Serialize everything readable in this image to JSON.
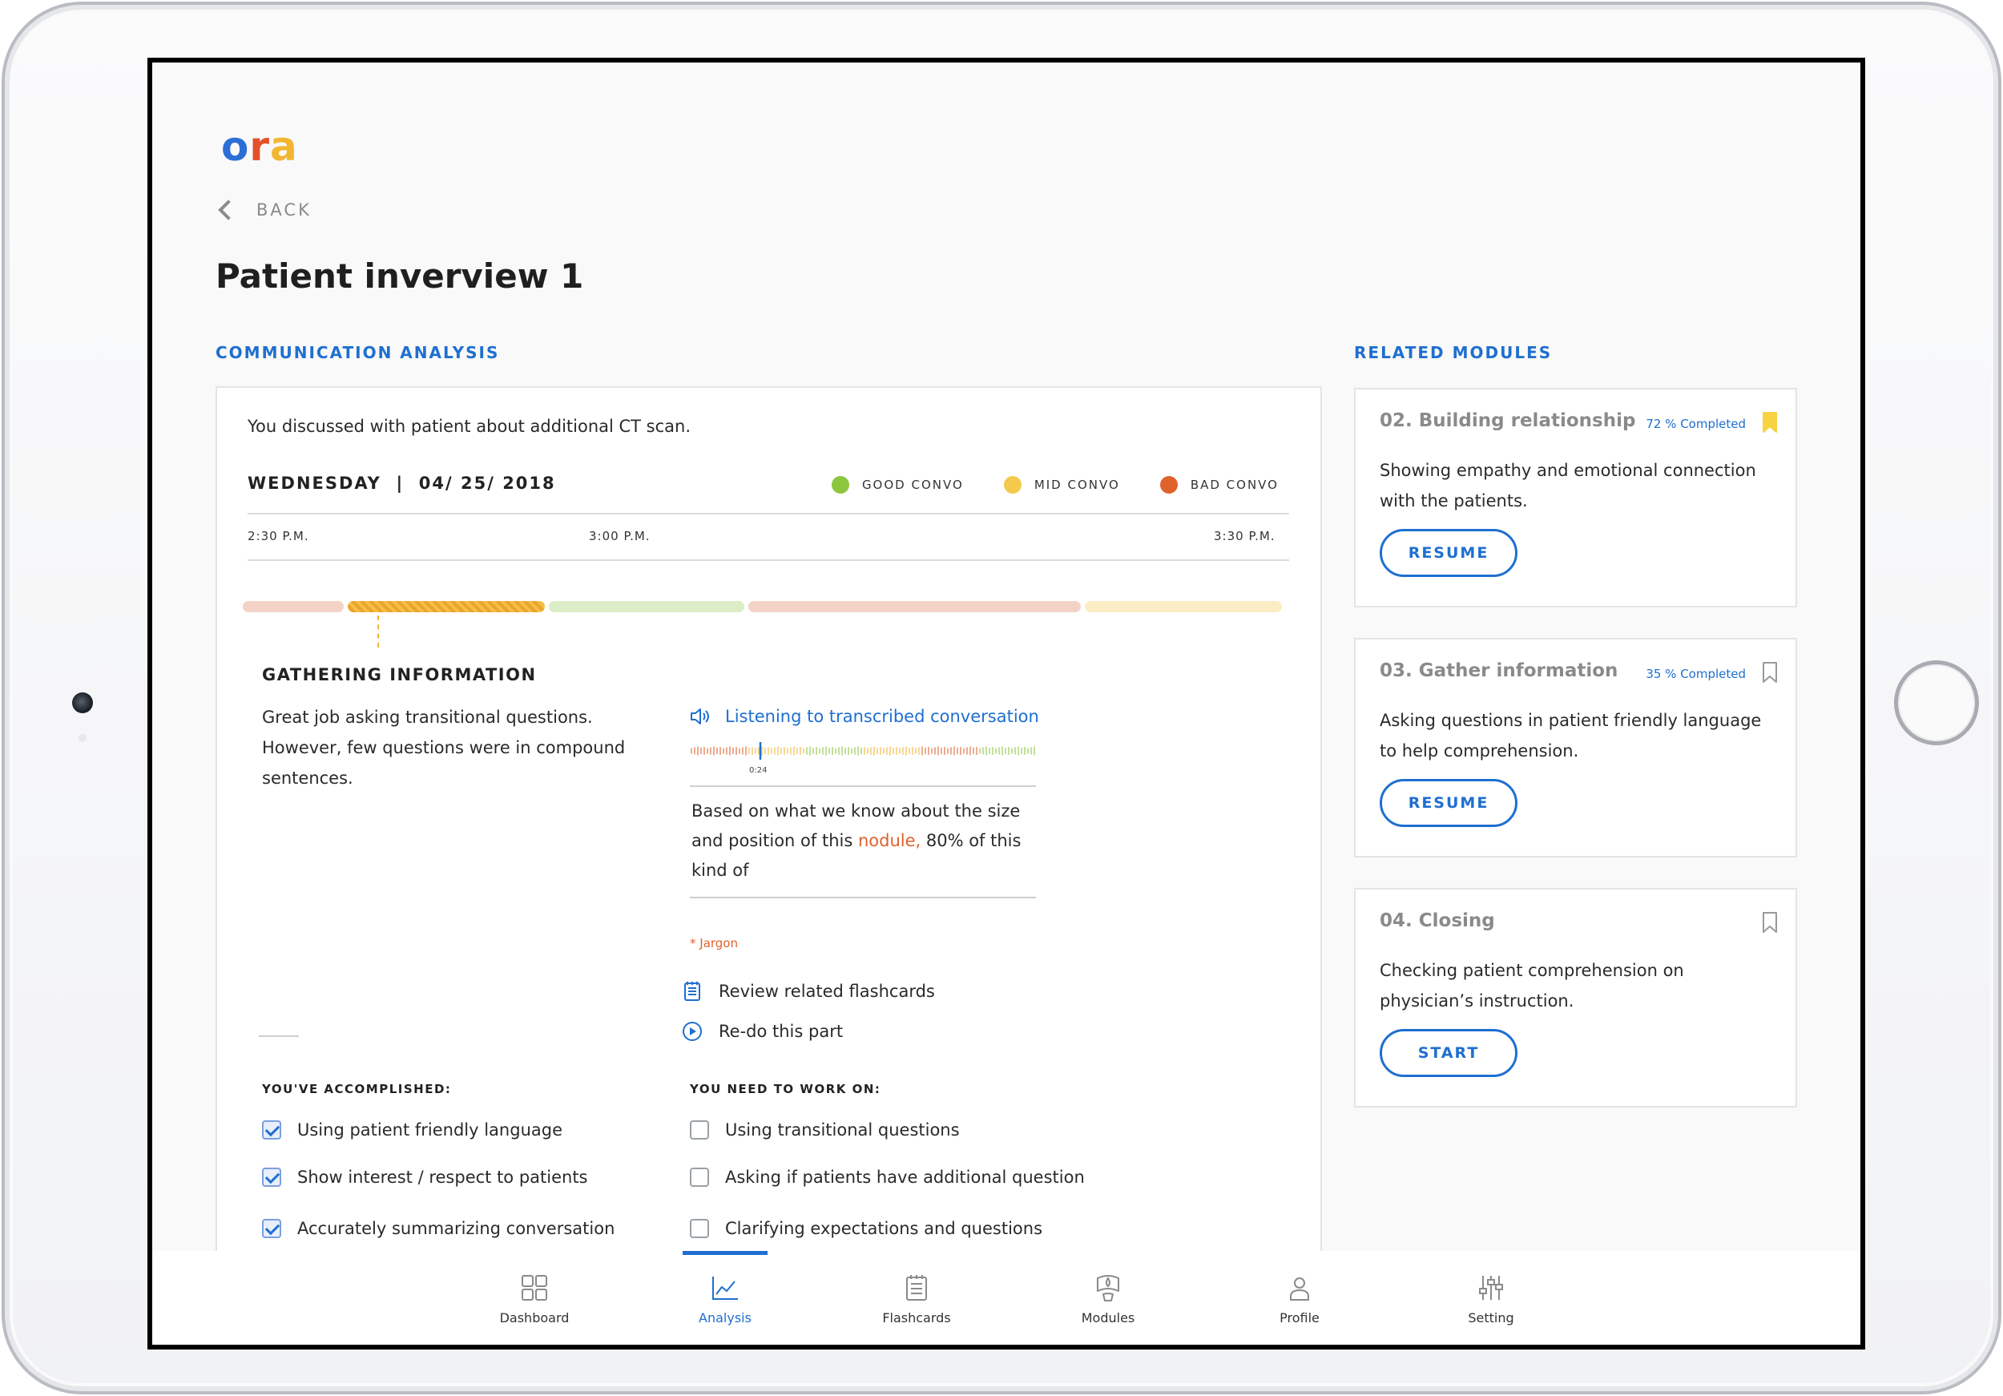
{
  "brand": {
    "logo_o": "o",
    "logo_r": "r",
    "logo_a": "a"
  },
  "nav_back": "BACK",
  "page_title": "Patient inverview 1",
  "analysis": {
    "section_label": "COMMUNICATION ANALYSIS",
    "summary": "You discussed with patient about additional CT scan.",
    "date": "WEDNESDAY  |  04/ 25/ 2018",
    "legend": [
      {
        "label": "GOOD CONVO",
        "color": "#8cc63f"
      },
      {
        "label": "MID CONVO",
        "color": "#f5c94c"
      },
      {
        "label": "BAD CONVO",
        "color": "#e0622b"
      }
    ],
    "times": [
      "2:30 P.M.",
      "3:00 P.M.",
      "3:30 P.M."
    ],
    "timeline_segments": [
      {
        "rating": "bad",
        "color": "#f4d3c6"
      },
      {
        "rating": "mid",
        "color": "#f2b632",
        "selected": true
      },
      {
        "rating": "good",
        "color": "#dcedc8"
      },
      {
        "rating": "bad",
        "color": "#f4d3c6"
      },
      {
        "rating": "mid",
        "color": "#fbedc4"
      }
    ],
    "segment_detail": {
      "title": "GATHERING INFORMATION",
      "feedback": "Great job asking transitional questions. However, few questions were in compound sentences.",
      "listen_label": "Listening to transcribed conversation",
      "audio_time": "0:24",
      "transcript_before": "Based on what we know about the size and position of this ",
      "transcript_jargon": "nodule,",
      "transcript_after": " 80% of this kind of",
      "jargon_note": "* Jargon",
      "action_flashcards": "Review related flashcards",
      "action_redo": "Re-do this part"
    },
    "accomplished_heading": "YOU'VE ACCOMPLISHED:",
    "accomplished": [
      {
        "label": "Using patient friendly language",
        "checked": true
      },
      {
        "label": "Show interest / respect to patients",
        "checked": true
      },
      {
        "label": "Accurately summarizing conversation",
        "checked": true
      }
    ],
    "work_on_heading": "YOU NEED TO WORK ON:",
    "work_on": [
      {
        "label": "Using transitional questions",
        "checked": false
      },
      {
        "label": "Asking if patients have additional question",
        "checked": false
      },
      {
        "label": "Clarifying expectations and questions",
        "checked": false
      }
    ]
  },
  "related": {
    "section_label": "RELATED MODULES",
    "modules": [
      {
        "title": "02. Building relationship",
        "progress": "72 % Completed",
        "bookmarked": true,
        "description": "Showing empathy and emotional connection with the patients.",
        "button": "RESUME"
      },
      {
        "title": "03. Gather information",
        "progress": "35 % Completed",
        "bookmarked": false,
        "description": "Asking questions in patient friendly language to help comprehension.",
        "button": "RESUME"
      },
      {
        "title": "04. Closing",
        "progress": "",
        "bookmarked": false,
        "description": "Checking patient comprehension on physician’s instruction.",
        "button": "START"
      }
    ]
  },
  "bottom_nav": [
    {
      "label": "Dashboard",
      "icon": "dashboard-icon",
      "active": false
    },
    {
      "label": "Analysis",
      "icon": "analysis-chart-icon",
      "active": true
    },
    {
      "label": "Flashcards",
      "icon": "flashcards-icon",
      "active": false
    },
    {
      "label": "Modules",
      "icon": "modules-icon",
      "active": false
    },
    {
      "label": "Profile",
      "icon": "profile-icon",
      "active": false
    },
    {
      "label": "Setting",
      "icon": "setting-sliders-icon",
      "active": false
    }
  ],
  "colors": {
    "accent": "#1e6fd0",
    "jargon": "#e0622b",
    "bookmark_active": "#f7d343"
  }
}
